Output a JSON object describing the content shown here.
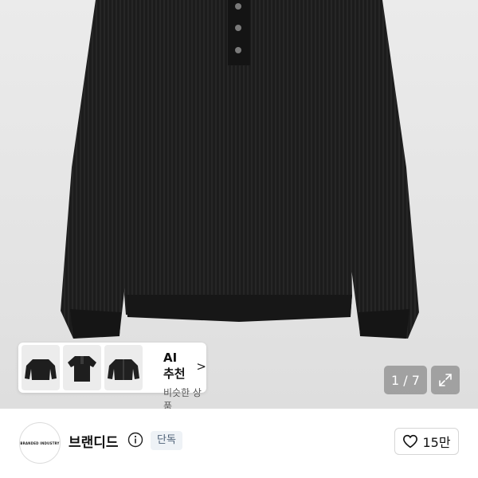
{
  "ai_card": {
    "title": "AI 추천",
    "chevron": ">",
    "subtitle": "비슷한 상품",
    "thumbnails": [
      "sweater-thumb-icon",
      "tshirt-thumb-icon",
      "cardigan-thumb-icon"
    ]
  },
  "pager": {
    "text": "1 / 7"
  },
  "brand": {
    "avatar_text": "BRANDED INDUSTRY",
    "name": "브랜디드",
    "tag": "단독"
  },
  "like": {
    "count": "15만"
  },
  "colors": {
    "sweater": "#1a1a1a",
    "tag_bg": "#eef2f6",
    "tag_text": "#4e6177"
  }
}
